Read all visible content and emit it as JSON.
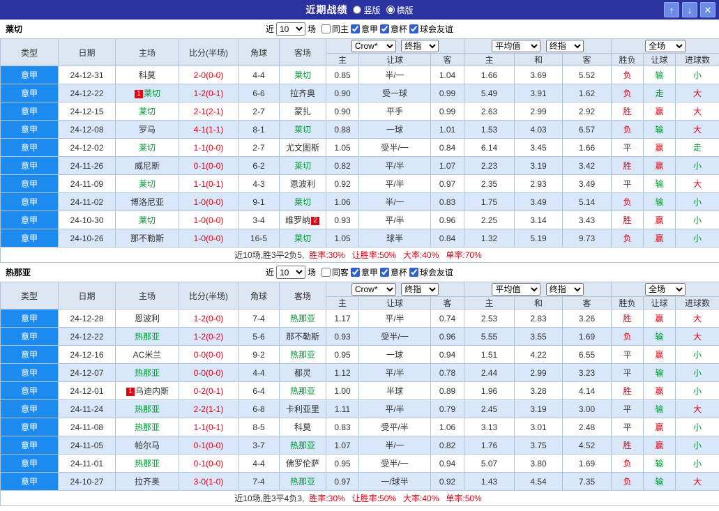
{
  "titlebar": {
    "title": "近期战绩",
    "layout_options": [
      {
        "label": "竖版",
        "selected": false
      },
      {
        "label": "横版",
        "selected": true
      }
    ],
    "up_icon": "↑",
    "down_icon": "↓",
    "close_icon": "✕"
  },
  "colors": {
    "titlebar_bg": "#2a32a0",
    "league_bg": "#1d8af0",
    "row_alt": "#d9e7fa",
    "header_bg": "#dce6f2",
    "border": "#b3c3da",
    "win_red": "#e60012",
    "lose_green": "#009933",
    "focal_team_green": "#009933",
    "score_red": "#e60012"
  },
  "table_header": {
    "cols": [
      "类型",
      "日期",
      "主场",
      "比分(半场)",
      "角球",
      "客场"
    ],
    "group1_selects": [
      "Crow*",
      "终指"
    ],
    "group2_selects": [
      "平均值",
      "终指"
    ],
    "group3_selects": [
      "全场"
    ],
    "sub": [
      "主",
      "让球",
      "客",
      "主",
      "和",
      "客",
      "胜负",
      "让球",
      "进球数"
    ]
  },
  "sections": [
    {
      "team": "莱切",
      "filter": {
        "prefix": "近",
        "count": "10",
        "suffix": "场",
        "checkboxes": [
          {
            "label": "同主",
            "checked": false
          },
          {
            "label": "意甲",
            "checked": true
          },
          {
            "label": "意杯",
            "checked": true
          },
          {
            "label": "球会友谊",
            "checked": true
          }
        ]
      },
      "rows": [
        {
          "league": "意甲",
          "date": "24-12-31",
          "home": {
            "name": "科莫"
          },
          "score": "2-0(0-0)",
          "corner": "4-4",
          "away": {
            "name": "莱切",
            "focal": true
          },
          "odds": [
            "0.85",
            "半/一",
            "1.04",
            "1.66",
            "3.69",
            "5.52"
          ],
          "results": [
            [
              "负",
              "red"
            ],
            [
              "输",
              "green"
            ],
            [
              "小",
              "green"
            ]
          ]
        },
        {
          "league": "意甲",
          "date": "24-12-22",
          "home": {
            "name": "莱切",
            "focal": true,
            "badge_before": "1"
          },
          "score": "1-2(0-1)",
          "corner": "6-6",
          "away": {
            "name": "拉齐奥"
          },
          "odds": [
            "0.90",
            "受一球",
            "0.99",
            "5.49",
            "3.91",
            "1.62"
          ],
          "results": [
            [
              "负",
              "red"
            ],
            [
              "走",
              "green"
            ],
            [
              "大",
              "red"
            ]
          ]
        },
        {
          "league": "意甲",
          "date": "24-12-15",
          "home": {
            "name": "莱切",
            "focal": true
          },
          "score": "2-1(2-1)",
          "corner": "2-7",
          "away": {
            "name": "蒙扎"
          },
          "odds": [
            "0.90",
            "平手",
            "0.99",
            "2.63",
            "2.99",
            "2.92"
          ],
          "results": [
            [
              "胜",
              "red"
            ],
            [
              "赢",
              "red"
            ],
            [
              "大",
              "red"
            ]
          ]
        },
        {
          "league": "意甲",
          "date": "24-12-08",
          "home": {
            "name": "罗马"
          },
          "score": "4-1(1-1)",
          "corner": "8-1",
          "away": {
            "name": "莱切",
            "focal": true
          },
          "odds": [
            "0.88",
            "一球",
            "1.01",
            "1.53",
            "4.03",
            "6.57"
          ],
          "results": [
            [
              "负",
              "red"
            ],
            [
              "输",
              "green"
            ],
            [
              "大",
              "red"
            ]
          ]
        },
        {
          "league": "意甲",
          "date": "24-12-02",
          "home": {
            "name": "莱切",
            "focal": true
          },
          "score": "1-1(0-0)",
          "corner": "2-7",
          "away": {
            "name": "尤文图斯"
          },
          "odds": [
            "1.05",
            "受半/一",
            "0.84",
            "6.14",
            "3.45",
            "1.66"
          ],
          "results": [
            [
              "平",
              "dark"
            ],
            [
              "赢",
              "red"
            ],
            [
              "走",
              "green"
            ]
          ]
        },
        {
          "league": "意甲",
          "date": "24-11-26",
          "home": {
            "name": "威尼斯"
          },
          "score": "0-1(0-0)",
          "corner": "6-2",
          "away": {
            "name": "莱切",
            "focal": true
          },
          "odds": [
            "0.82",
            "平/半",
            "1.07",
            "2.23",
            "3.19",
            "3.42"
          ],
          "results": [
            [
              "胜",
              "red"
            ],
            [
              "赢",
              "red"
            ],
            [
              "小",
              "green"
            ]
          ]
        },
        {
          "league": "意甲",
          "date": "24-11-09",
          "home": {
            "name": "莱切",
            "focal": true
          },
          "score": "1-1(0-1)",
          "corner": "4-3",
          "away": {
            "name": "恩波利"
          },
          "odds": [
            "0.92",
            "平/半",
            "0.97",
            "2.35",
            "2.93",
            "3.49"
          ],
          "results": [
            [
              "平",
              "dark"
            ],
            [
              "输",
              "green"
            ],
            [
              "大",
              "red"
            ]
          ]
        },
        {
          "league": "意甲",
          "date": "24-11-02",
          "home": {
            "name": "博洛尼亚"
          },
          "score": "1-0(0-0)",
          "corner": "9-1",
          "away": {
            "name": "莱切",
            "focal": true
          },
          "odds": [
            "1.06",
            "半/一",
            "0.83",
            "1.75",
            "3.49",
            "5.14"
          ],
          "results": [
            [
              "负",
              "red"
            ],
            [
              "输",
              "green"
            ],
            [
              "小",
              "green"
            ]
          ]
        },
        {
          "league": "意甲",
          "date": "24-10-30",
          "home": {
            "name": "莱切",
            "focal": true
          },
          "score": "1-0(0-0)",
          "corner": "3-4",
          "away": {
            "name": "维罗纳",
            "badge_after": "2"
          },
          "odds": [
            "0.93",
            "平/半",
            "0.96",
            "2.25",
            "3.14",
            "3.43"
          ],
          "results": [
            [
              "胜",
              "red"
            ],
            [
              "赢",
              "red"
            ],
            [
              "小",
              "green"
            ]
          ]
        },
        {
          "league": "意甲",
          "date": "24-10-26",
          "home": {
            "name": "那不勒斯"
          },
          "score": "1-0(0-0)",
          "corner": "16-5",
          "away": {
            "name": "莱切",
            "focal": true
          },
          "odds": [
            "1.05",
            "球半",
            "0.84",
            "1.32",
            "5.19",
            "9.73"
          ],
          "results": [
            [
              "负",
              "red"
            ],
            [
              "赢",
              "red"
            ],
            [
              "小",
              "green"
            ]
          ]
        }
      ],
      "summary": {
        "prefix": "近10场,胜3平2负5,",
        "rates": [
          "胜率:30%",
          "让胜率:50%",
          "大率:40%",
          "单率:70%"
        ]
      }
    },
    {
      "team": "热那亚",
      "filter": {
        "prefix": "近",
        "count": "10",
        "suffix": "场",
        "checkboxes": [
          {
            "label": "同客",
            "checked": false
          },
          {
            "label": "意甲",
            "checked": true
          },
          {
            "label": "意杯",
            "checked": true
          },
          {
            "label": "球会友谊",
            "checked": true
          }
        ]
      },
      "rows": [
        {
          "league": "意甲",
          "date": "24-12-28",
          "home": {
            "name": "恩波利"
          },
          "score": "1-2(0-0)",
          "corner": "7-4",
          "away": {
            "name": "热那亚",
            "focal": true
          },
          "odds": [
            "1.17",
            "平/半",
            "0.74",
            "2.53",
            "2.83",
            "3.26"
          ],
          "results": [
            [
              "胜",
              "red"
            ],
            [
              "赢",
              "red"
            ],
            [
              "大",
              "red"
            ]
          ]
        },
        {
          "league": "意甲",
          "date": "24-12-22",
          "home": {
            "name": "热那亚",
            "focal": true
          },
          "score": "1-2(0-2)",
          "corner": "5-6",
          "away": {
            "name": "那不勒斯"
          },
          "odds": [
            "0.93",
            "受半/一",
            "0.96",
            "5.55",
            "3.55",
            "1.69"
          ],
          "results": [
            [
              "负",
              "red"
            ],
            [
              "输",
              "green"
            ],
            [
              "大",
              "red"
            ]
          ]
        },
        {
          "league": "意甲",
          "date": "24-12-16",
          "home": {
            "name": "AC米兰"
          },
          "score": "0-0(0-0)",
          "corner": "9-2",
          "away": {
            "name": "热那亚",
            "focal": true
          },
          "odds": [
            "0.95",
            "一球",
            "0.94",
            "1.51",
            "4.22",
            "6.55"
          ],
          "results": [
            [
              "平",
              "dark"
            ],
            [
              "赢",
              "red"
            ],
            [
              "小",
              "green"
            ]
          ]
        },
        {
          "league": "意甲",
          "date": "24-12-07",
          "home": {
            "name": "热那亚",
            "focal": true
          },
          "score": "0-0(0-0)",
          "corner": "4-4",
          "away": {
            "name": "都灵"
          },
          "odds": [
            "1.12",
            "平/半",
            "0.78",
            "2.44",
            "2.99",
            "3.23"
          ],
          "results": [
            [
              "平",
              "dark"
            ],
            [
              "输",
              "green"
            ],
            [
              "小",
              "green"
            ]
          ]
        },
        {
          "league": "意甲",
          "date": "24-12-01",
          "home": {
            "name": "乌迪内斯",
            "badge_before": "1"
          },
          "score": "0-2(0-1)",
          "corner": "6-4",
          "away": {
            "name": "热那亚",
            "focal": true
          },
          "odds": [
            "1.00",
            "半球",
            "0.89",
            "1.96",
            "3.28",
            "4.14"
          ],
          "results": [
            [
              "胜",
              "red"
            ],
            [
              "赢",
              "red"
            ],
            [
              "小",
              "green"
            ]
          ]
        },
        {
          "league": "意甲",
          "date": "24-11-24",
          "home": {
            "name": "热那亚",
            "focal": true
          },
          "score": "2-2(1-1)",
          "corner": "6-8",
          "away": {
            "name": "卡利亚里"
          },
          "odds": [
            "1.11",
            "平/半",
            "0.79",
            "2.45",
            "3.19",
            "3.00"
          ],
          "results": [
            [
              "平",
              "dark"
            ],
            [
              "输",
              "green"
            ],
            [
              "大",
              "red"
            ]
          ]
        },
        {
          "league": "意甲",
          "date": "24-11-08",
          "home": {
            "name": "热那亚",
            "focal": true
          },
          "score": "1-1(0-1)",
          "corner": "8-5",
          "away": {
            "name": "科莫"
          },
          "odds": [
            "0.83",
            "受平/半",
            "1.06",
            "3.13",
            "3.01",
            "2.48"
          ],
          "results": [
            [
              "平",
              "dark"
            ],
            [
              "赢",
              "red"
            ],
            [
              "小",
              "green"
            ]
          ]
        },
        {
          "league": "意甲",
          "date": "24-11-05",
          "home": {
            "name": "帕尔马"
          },
          "score": "0-1(0-0)",
          "corner": "3-7",
          "away": {
            "name": "热那亚",
            "focal": true
          },
          "odds": [
            "1.07",
            "半/一",
            "0.82",
            "1.76",
            "3.75",
            "4.52"
          ],
          "results": [
            [
              "胜",
              "red"
            ],
            [
              "赢",
              "red"
            ],
            [
              "小",
              "green"
            ]
          ]
        },
        {
          "league": "意甲",
          "date": "24-11-01",
          "home": {
            "name": "热那亚",
            "focal": true
          },
          "score": "0-1(0-0)",
          "corner": "4-4",
          "away": {
            "name": "佛罗伦萨"
          },
          "odds": [
            "0.95",
            "受半/一",
            "0.94",
            "5.07",
            "3.80",
            "1.69"
          ],
          "results": [
            [
              "负",
              "red"
            ],
            [
              "输",
              "green"
            ],
            [
              "小",
              "green"
            ]
          ]
        },
        {
          "league": "意甲",
          "date": "24-10-27",
          "home": {
            "name": "拉齐奥"
          },
          "score": "3-0(1-0)",
          "corner": "7-4",
          "away": {
            "name": "热那亚",
            "focal": true
          },
          "odds": [
            "0.97",
            "一/球半",
            "0.92",
            "1.43",
            "4.54",
            "7.35"
          ],
          "results": [
            [
              "负",
              "red"
            ],
            [
              "输",
              "green"
            ],
            [
              "大",
              "red"
            ]
          ]
        }
      ],
      "summary": {
        "prefix": "近10场,胜3平4负3,",
        "rates": [
          "胜率:30%",
          "让胜率:50%",
          "大率:40%",
          "单率:50%"
        ]
      }
    }
  ]
}
